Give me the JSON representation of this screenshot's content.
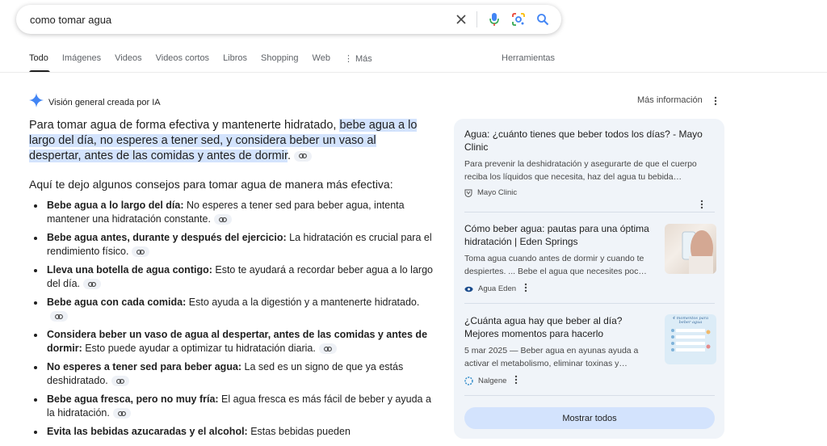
{
  "search": {
    "query": "como tomar agua"
  },
  "tabs": [
    "Todo",
    "Imágenes",
    "Videos",
    "Videos cortos",
    "Libros",
    "Shopping",
    "Web",
    "Más"
  ],
  "tools_label": "Herramientas",
  "ai_overview": {
    "title": "Visión general creada por IA",
    "more_info": "Más información",
    "intro_plain": "Para tomar agua de forma efectiva y mantenerte hidratado, ",
    "intro_highlight": "bebe agua a lo largo del día, no esperes a tener sed, y considera beber un vaso al despertar, antes de las comidas y antes de dormir",
    "intro_end": ".",
    "tips_heading": "Aquí te dejo algunos consejos para tomar agua de manera más efectiva:",
    "tips": [
      {
        "bold": "Bebe agua a lo largo del día:",
        "text": " No esperes a tener sed para beber agua, intenta mantener una hidratación constante."
      },
      {
        "bold": "Bebe agua antes, durante y después del ejercicio:",
        "text": " La hidratación es crucial para el rendimiento físico."
      },
      {
        "bold": "Lleva una botella de agua contigo:",
        "text": " Esto te ayudará a recordar beber agua a lo largo del día."
      },
      {
        "bold": "Bebe agua con cada comida:",
        "text": " Esto ayuda a la digestión y a mantenerte hidratado."
      },
      {
        "bold": "Considera beber un vaso de agua al despertar, antes de las comidas y antes de dormir:",
        "text": " Esto puede ayudar a optimizar tu hidratación diaria."
      },
      {
        "bold": "No esperes a tener sed para beber agua:",
        "text": " La sed es un signo de que ya estás deshidratado."
      },
      {
        "bold": "Bebe agua fresca, pero no muy fría:",
        "text": " El agua fresca es más fácil de beber y ayuda a la hidratación."
      },
      {
        "bold": "Evita las bebidas azucaradas y el alcohol:",
        "text": " Estas bebidas pueden"
      }
    ]
  },
  "sources": [
    {
      "title": "Agua: ¿cuánto tienes que beber todos los días? - Mayo Clinic",
      "snippet": "Para prevenir la deshidratación y asegurarte de que el cuerpo reciba los líquidos que necesita, haz del agua tu bebida…",
      "site": "Mayo Clinic"
    },
    {
      "title": "Cómo beber agua: pautas para una óptima hidratación | Eden Springs",
      "snippet": "Toma agua cuando antes de dormir y cuando te despiertes. ... Bebe el agua que necesites poc…",
      "site": "Agua Eden"
    },
    {
      "title": "¿Cuánta agua hay que beber al día? Mejores momentos para hacerlo",
      "snippet": "5 mar 2025 — Beber agua en ayunas ayuda a activar el metabolismo, eliminar toxinas y…",
      "site": "Nalgene",
      "thumb_text": "4 momentos para beber agua"
    }
  ],
  "show_all": "Mostrar todos",
  "colors": {
    "accent": "#1a73e8",
    "highlight": "#d3e3fd",
    "panel": "#f0f4f9"
  }
}
